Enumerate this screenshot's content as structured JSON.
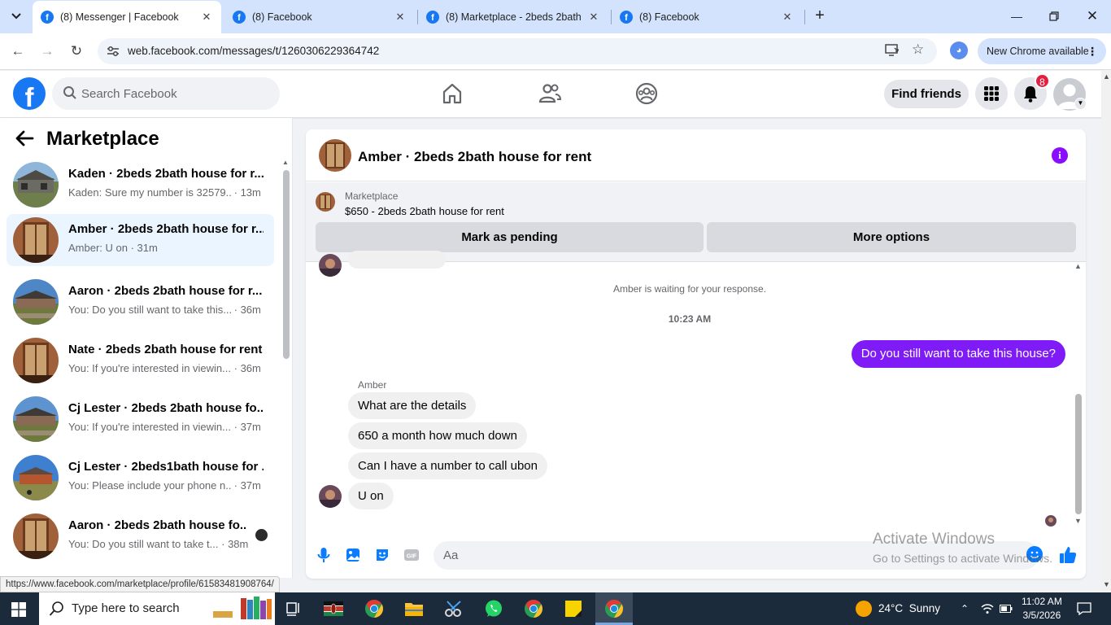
{
  "browser": {
    "tabs": [
      {
        "title": "(8) Messenger | Facebook",
        "active": true
      },
      {
        "title": "(8) Facebook",
        "active": false
      },
      {
        "title": "(8) Marketplace - 2beds 2bath",
        "active": false
      },
      {
        "title": "(8) Facebook",
        "active": false
      }
    ],
    "url": "web.facebook.com/messages/t/1260306229364742",
    "update_label": "New Chrome available",
    "status_url": "https://www.facebook.com/marketplace/profile/61583481908764/"
  },
  "header": {
    "search_placeholder": "Search Facebook",
    "find_friends_label": "Find friends",
    "notification_count": "8",
    "brand_color": "#1877f2"
  },
  "sidebar": {
    "title": "Marketplace",
    "conversations": [
      {
        "name": "Kaden · 2beds 2bath house for r...",
        "preview": "Kaden: Sure my number is 32579...",
        "time": "· 13m",
        "active": false
      },
      {
        "name": "Amber · 2beds 2bath house for r...",
        "preview": "Amber: U on",
        "time": "· 31m",
        "active": true
      },
      {
        "name": "Aaron · 2beds 2bath house for r...",
        "preview": "You: Do you still want to take this...",
        "time": "· 36m",
        "active": false
      },
      {
        "name": "Nate · 2beds 2bath house for rent",
        "preview": "You: If you're interested in viewin...",
        "time": "· 36m",
        "active": false
      },
      {
        "name": "Cj Lester · 2beds 2bath house fo...",
        "preview": "You: If you're interested in viewin...",
        "time": "· 37m",
        "active": false
      },
      {
        "name": "Cj Lester · 2beds1bath house for ...",
        "preview": "You: Please include your phone n...",
        "time": "· 37m",
        "active": false
      },
      {
        "name": "Aaron · 2beds 2bath house fo...",
        "preview": "You: Do you still want to take t...",
        "time": "· 38m",
        "active": false,
        "unread": true
      }
    ]
  },
  "chat": {
    "title": "Amber · 2beds 2bath house for rent",
    "marketplace_label": "Marketplace",
    "listing": "$650 - 2beds 2bath house for rent",
    "mark_pending_label": "Mark as pending",
    "more_options_label": "More options",
    "waiting_notice": "Amber is waiting for your response.",
    "timestamp": "10:23 AM",
    "outgoing_message": "Do you still want to take this house?",
    "sender_name": "Amber",
    "incoming_messages": [
      "What are the details",
      "650 a month how much down",
      "Can I have a number to call ubon",
      "U on"
    ],
    "composer_placeholder": "Aa",
    "accent_color": "#7e1bf6"
  },
  "watermark": {
    "line1": "Activate Windows",
    "line2": "Go to Settings to activate Windows."
  },
  "taskbar": {
    "search_placeholder": "Type here to search",
    "weather_temp": "24°C",
    "weather_desc": "Sunny",
    "time": "11:02 AM",
    "date": "3/5/2026"
  }
}
